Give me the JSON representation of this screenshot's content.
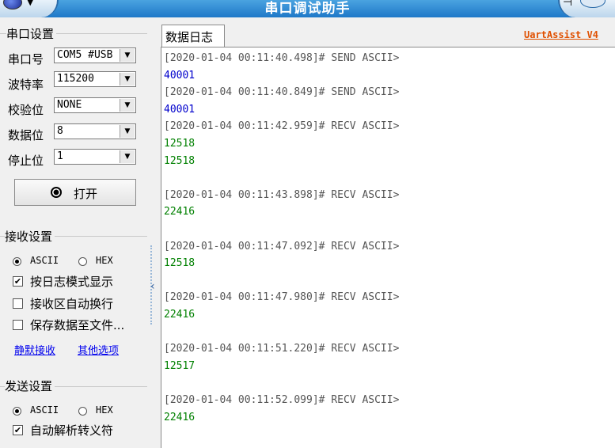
{
  "app": {
    "title": "串口调试助手",
    "brand": "UartAssist V4"
  },
  "serial_settings": {
    "group_title": "串口设置",
    "port": {
      "label": "串口号",
      "value": "COM5 #USB"
    },
    "baud": {
      "label": "波特率",
      "value": "115200"
    },
    "parity": {
      "label": "校验位",
      "value": "NONE"
    },
    "databits": {
      "label": "数据位",
      "value": "8"
    },
    "stopbits": {
      "label": "停止位",
      "value": "1"
    },
    "open_label": "打开"
  },
  "receive_settings": {
    "group_title": "接收设置",
    "ascii_label": "ASCII",
    "hex_label": "HEX",
    "mode": "ASCII",
    "log_mode": {
      "label": "按日志模式显示",
      "checked": true
    },
    "auto_wrap": {
      "label": "接收区自动换行",
      "checked": false
    },
    "save_file": {
      "label": "保存数据至文件...",
      "checked": false
    },
    "silent_link": "静默接收",
    "other_link": "其他选项"
  },
  "send_settings": {
    "group_title": "发送设置",
    "ascii_label": "ASCII",
    "hex_label": "HEX",
    "mode": "ASCII",
    "auto_escape": {
      "label": "自动解析转义符",
      "checked": true
    }
  },
  "tab": {
    "label": "数据日志"
  },
  "log": [
    {
      "header": "[2020-01-04 00:11:40.498]# SEND ASCII>",
      "type": "send",
      "lines": [
        "40001"
      ]
    },
    {
      "header": "[2020-01-04 00:11:40.849]# SEND ASCII>",
      "type": "send",
      "lines": [
        "40001"
      ]
    },
    {
      "header": "[2020-01-04 00:11:42.959]# RECV ASCII>",
      "type": "recv",
      "lines": [
        "12518",
        "12518"
      ]
    },
    {
      "header": "[2020-01-04 00:11:43.898]# RECV ASCII>",
      "type": "recv",
      "lines": [
        "22416"
      ]
    },
    {
      "header": "[2020-01-04 00:11:47.092]# RECV ASCII>",
      "type": "recv",
      "lines": [
        "12518"
      ]
    },
    {
      "header": "[2020-01-04 00:11:47.980]# RECV ASCII>",
      "type": "recv",
      "lines": [
        "22416"
      ]
    },
    {
      "header": "[2020-01-04 00:11:51.220]# RECV ASCII>",
      "type": "recv",
      "lines": [
        "12517"
      ]
    },
    {
      "header": "[2020-01-04 00:11:52.099]# RECV ASCII>",
      "type": "recv",
      "lines": [
        "22416"
      ]
    }
  ],
  "colors": {
    "send_text": "#0000cc",
    "recv_text": "#008000",
    "brand": "#e05000",
    "titlebar": "#1e78c8"
  }
}
